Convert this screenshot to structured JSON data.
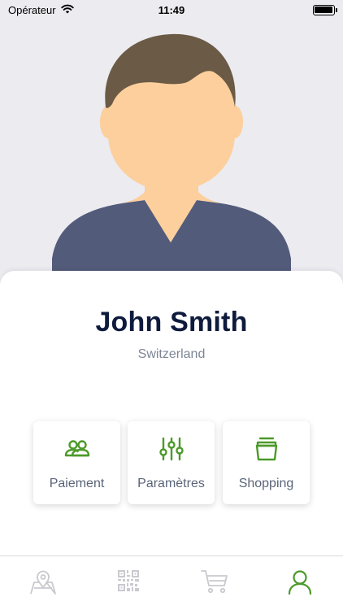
{
  "status_bar": {
    "carrier": "Opérateur",
    "time": "11:49",
    "battery_level": 1.0
  },
  "profile": {
    "name": "John Smith",
    "country": "Switzerland"
  },
  "actions": [
    {
      "label": "Paiement",
      "icon": "people-icon"
    },
    {
      "label": "Paramètres",
      "icon": "sliders-icon"
    },
    {
      "label": "Shopping",
      "icon": "basket-icon"
    }
  ],
  "tab_bar": {
    "tabs": [
      {
        "icon": "map-icon",
        "active": false
      },
      {
        "icon": "qr-code-icon",
        "active": false
      },
      {
        "icon": "cart-icon",
        "active": false
      },
      {
        "icon": "profile-icon",
        "active": true
      }
    ]
  },
  "colors": {
    "accent_green": "#4c9a2a",
    "inactive_icon": "#c9c9cf",
    "name_color": "#0f1b3d",
    "avatar_hair": "#6b5a45",
    "avatar_skin": "#fccf9c",
    "avatar_shirt": "#535b7a",
    "avatar_bg": "#ebebf0"
  }
}
